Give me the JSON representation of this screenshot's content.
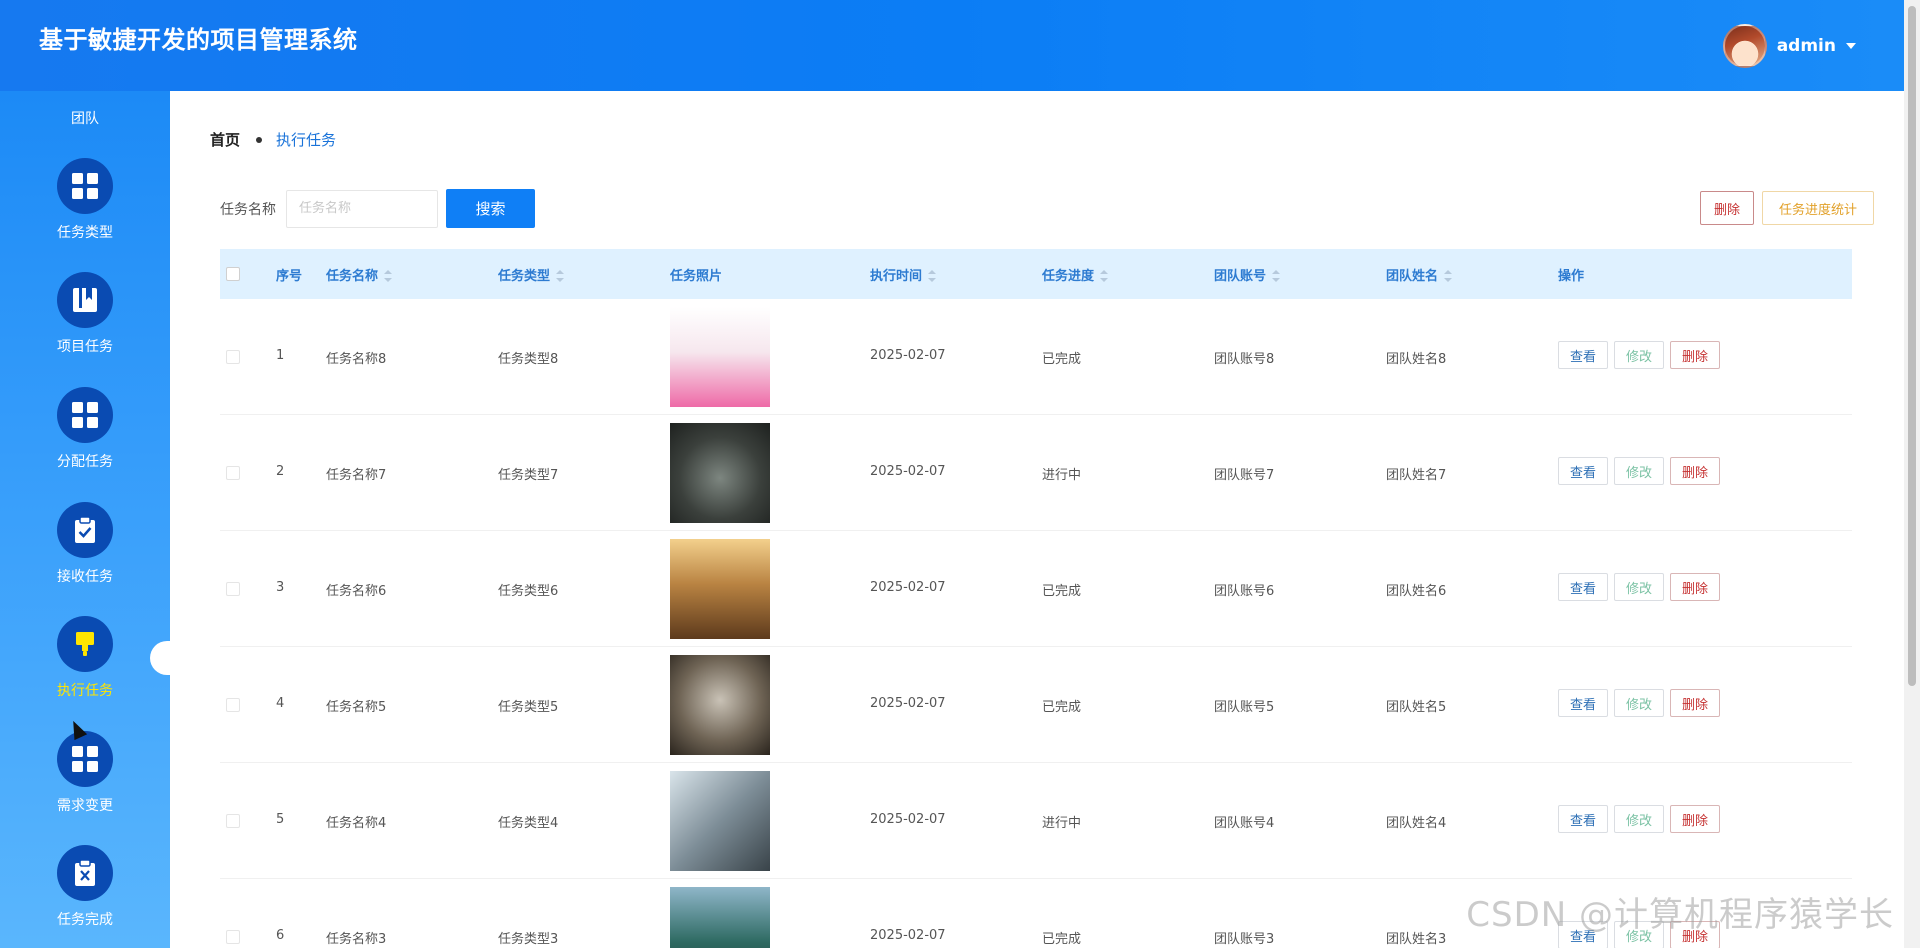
{
  "header": {
    "title": "基于敏捷开发的项目管理系统",
    "username": "admin"
  },
  "sidebar": {
    "top_label": "团队",
    "items": [
      {
        "label": "任务类型",
        "icon": "grid-icon",
        "active": false
      },
      {
        "label": "项目任务",
        "icon": "book-icon",
        "active": false
      },
      {
        "label": "分配任务",
        "icon": "grid-icon",
        "active": false
      },
      {
        "label": "接收任务",
        "icon": "clipboard-check-icon",
        "active": false
      },
      {
        "label": "执行任务",
        "icon": "brush-icon",
        "active": true
      },
      {
        "label": "需求变更",
        "icon": "grid-icon",
        "active": false
      },
      {
        "label": "任务完成",
        "icon": "clipboard-x-icon",
        "active": false
      }
    ]
  },
  "breadcrumb": {
    "home": "首页",
    "current": "执行任务"
  },
  "search": {
    "label": "任务名称",
    "placeholder": "任务名称",
    "button": "搜索"
  },
  "actions": {
    "delete": "删除",
    "stats": "任务进度统计"
  },
  "table": {
    "headers": {
      "index": "序号",
      "name": "任务名称",
      "type": "任务类型",
      "photo": "任务照片",
      "time": "执行时间",
      "progress": "任务进度",
      "account": "团队账号",
      "member": "团队姓名",
      "ops": "操作"
    },
    "op_labels": {
      "view": "查看",
      "edit": "修改",
      "delete": "删除"
    },
    "rows": [
      {
        "index": "1",
        "name": "任务名称8",
        "type": "任务类型8",
        "time": "2025-02-07",
        "progress": "已完成",
        "account": "团队账号8",
        "member": "团队姓名8",
        "photo": "anime"
      },
      {
        "index": "2",
        "name": "任务名称7",
        "type": "任务类型7",
        "time": "2025-02-07",
        "progress": "进行中",
        "account": "团队账号7",
        "member": "团队姓名7",
        "photo": "dark-army"
      },
      {
        "index": "3",
        "name": "任务名称6",
        "type": "任务类型6",
        "time": "2025-02-07",
        "progress": "已完成",
        "account": "团队账号6",
        "member": "团队姓名6",
        "photo": "golden-city"
      },
      {
        "index": "4",
        "name": "任务名称5",
        "type": "任务类型5",
        "time": "2025-02-07",
        "progress": "已完成",
        "account": "团队账号5",
        "member": "团队姓名5",
        "photo": "monkey-king"
      },
      {
        "index": "5",
        "name": "任务名称4",
        "type": "任务类型4",
        "time": "2025-02-07",
        "progress": "进行中",
        "account": "团队账号4",
        "member": "团队姓名4",
        "photo": "cliff-ruins"
      },
      {
        "index": "6",
        "name": "任务名称3",
        "type": "任务类型3",
        "time": "2025-02-07",
        "progress": "已完成",
        "account": "团队账号3",
        "member": "团队姓名3",
        "photo": "green-valley"
      }
    ]
  },
  "watermark": "CSDN @计算机程序猿学长",
  "colors": {
    "header": "#0b7df5",
    "sidebar": "#2e96f9",
    "icon_circle": "#0a4bb2",
    "active_label": "#ffe600",
    "table_header_bg": "#dff1ff",
    "primary_button": "#0f7ff6"
  }
}
